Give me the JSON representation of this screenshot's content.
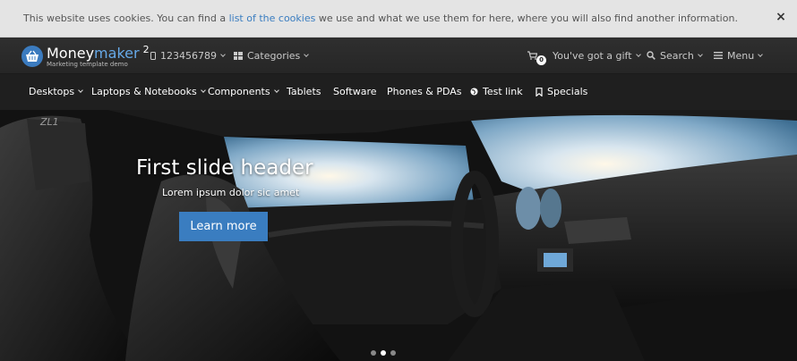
{
  "cookie": {
    "text_before": "This website uses cookies. You can find a ",
    "link_text": "list of the cookies",
    "text_after": " we use and what we use them for here, where you will also find another information.",
    "close_label": "×"
  },
  "header": {
    "logo_money": "Money",
    "logo_maker": "maker",
    "logo_version": "2",
    "logo_tagline": "Marketing template demo",
    "phone": "123456789",
    "categories": "Categories",
    "cart_count": "0",
    "gift": "You've got a gift",
    "search": "Search",
    "menu": "Menu"
  },
  "nav": {
    "items": [
      {
        "label": "Desktops"
      },
      {
        "label": "Laptops & Notebooks"
      },
      {
        "label": "Components"
      },
      {
        "label": "Tablets"
      },
      {
        "label": "Software"
      },
      {
        "label": "Phones & PDAs"
      },
      {
        "label": "Test link"
      },
      {
        "label": "Specials"
      }
    ]
  },
  "slide": {
    "title": "First slide header",
    "subtitle": "Lorem ipsum dolor sic amet",
    "button": "Learn more",
    "active_index": 1,
    "total": 3
  },
  "colors": {
    "accent": "#3a7dc0",
    "nav_bg": "#1f1f1f",
    "cookie_bg": "#e4e4e4"
  }
}
